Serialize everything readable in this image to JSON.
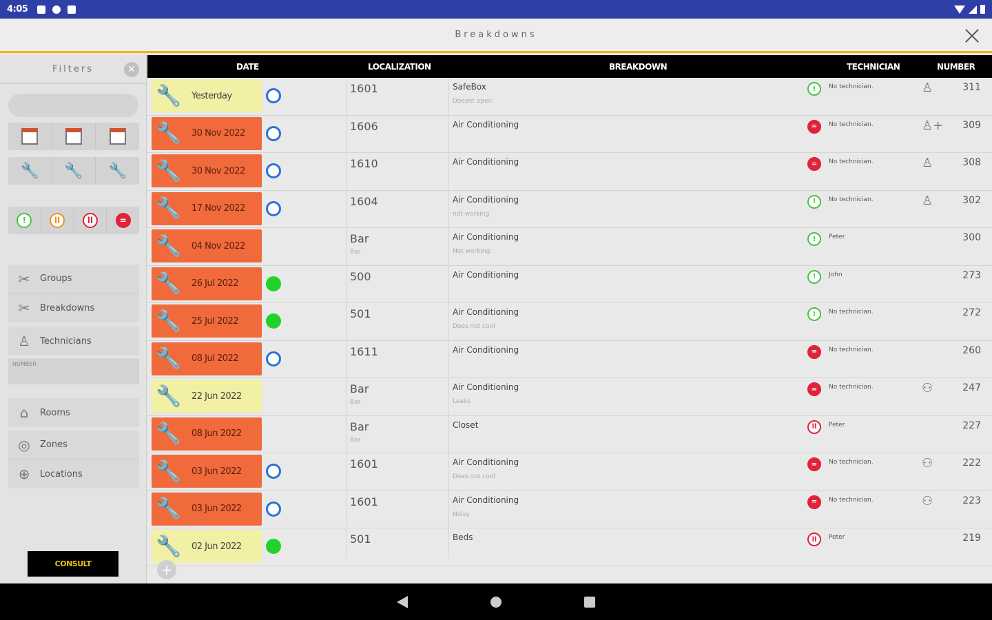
{
  "status_bar": {
    "time": "4:05"
  },
  "header": {
    "title": "Breakdowns"
  },
  "filters": {
    "title": "Filters",
    "clear_icon": "clear-circle-icon"
  },
  "sidebar_menu": {
    "group1": [
      {
        "label": "Groups",
        "icon": "tools-icon"
      },
      {
        "label": "Breakdowns",
        "icon": "tools-icon"
      }
    ],
    "technicians": {
      "label": "Technicians",
      "icon": "person-icon"
    },
    "number_label": "NUMBER",
    "group2": [
      {
        "label": "Rooms",
        "icon": "door-icon"
      },
      {
        "label": "Zones",
        "icon": "zone-icon"
      },
      {
        "label": "Locations",
        "icon": "globe-icon"
      }
    ]
  },
  "consult_label": "CONSULT",
  "table": {
    "columns": {
      "date": "DATE",
      "localization": "LOCALIZATION",
      "breakdown": "BREAKDOWN",
      "technician": "TECHNICIAN",
      "number": "NUMBER"
    },
    "rows": [
      {
        "date": "Yesterday",
        "color": "yellow",
        "user": "blue",
        "loc": "1601",
        "loc_sub": "",
        "bd": "SafeBox",
        "bd_sub": "Doesnt open",
        "status": "open",
        "tech": "No technician.",
        "num_icon": "person-icon",
        "number": "311"
      },
      {
        "date": "30 Nov 2022",
        "color": "red",
        "user": "blue",
        "loc": "1606",
        "loc_sub": "",
        "bd": "Air Conditioning",
        "bd_sub": "",
        "status": "stop",
        "tech": "No technician.",
        "num_icon": "person-add-icon",
        "number": "309"
      },
      {
        "date": "30 Nov 2022",
        "color": "red",
        "user": "blue",
        "loc": "1610",
        "loc_sub": "",
        "bd": "Air Conditioning",
        "bd_sub": "",
        "status": "stop",
        "tech": "No technician.",
        "num_icon": "person-icon",
        "number": "308"
      },
      {
        "date": "17 Nov 2022",
        "color": "red",
        "user": "blue",
        "loc": "1604",
        "loc_sub": "",
        "bd": "Air Conditioning",
        "bd_sub": "not working",
        "status": "open",
        "tech": "No technician.",
        "num_icon": "person-icon",
        "number": "302"
      },
      {
        "date": "04 Nov 2022",
        "color": "red",
        "user": "",
        "loc": "Bar",
        "loc_sub": "Bar",
        "bd": "Air Conditioning",
        "bd_sub": "Not working",
        "status": "open",
        "tech": "Peter",
        "num_icon": "",
        "number": "300"
      },
      {
        "date": "26 Jul 2022",
        "color": "red",
        "user": "green",
        "loc": "500",
        "loc_sub": "",
        "bd": "Air Conditioning",
        "bd_sub": "",
        "status": "open",
        "tech": "John",
        "num_icon": "",
        "number": "273"
      },
      {
        "date": "25 Jul 2022",
        "color": "red",
        "user": "green",
        "loc": "501",
        "loc_sub": "",
        "bd": "Air Conditioning",
        "bd_sub": "Does not cool",
        "status": "open",
        "tech": "No technician.",
        "num_icon": "",
        "number": "272"
      },
      {
        "date": "08 Jul 2022",
        "color": "red",
        "user": "blue",
        "loc": "1611",
        "loc_sub": "",
        "bd": "Air Conditioning",
        "bd_sub": "",
        "status": "stop",
        "tech": "No technician.",
        "num_icon": "",
        "number": "260"
      },
      {
        "date": "22 Jun 2022",
        "color": "yellow",
        "user": "",
        "loc": "Bar",
        "loc_sub": "Bar",
        "bd": "Air Conditioning",
        "bd_sub": "Leaks",
        "status": "stop",
        "tech": "No technician.",
        "num_icon": "group-icon",
        "number": "247"
      },
      {
        "date": "08 Jun 2022",
        "color": "red",
        "user": "",
        "loc": "Bar",
        "loc_sub": "Bar",
        "bd": "Closet",
        "bd_sub": "",
        "status": "paused",
        "tech": "Peter",
        "num_icon": "",
        "number": "227"
      },
      {
        "date": "03 Jun 2022",
        "color": "red",
        "user": "blue",
        "loc": "1601",
        "loc_sub": "",
        "bd": "Air Conditioning",
        "bd_sub": "Does not cool",
        "status": "stop",
        "tech": "No technician.",
        "num_icon": "group-icon",
        "number": "222"
      },
      {
        "date": "03 Jun 2022",
        "color": "red",
        "user": "blue",
        "loc": "1601",
        "loc_sub": "",
        "bd": "Air Conditioning",
        "bd_sub": "Noisy",
        "status": "stop",
        "tech": "No technician.",
        "num_icon": "group-icon",
        "number": "223"
      },
      {
        "date": "02 Jun 2022",
        "color": "yellow",
        "user": "green",
        "loc": "501",
        "loc_sub": "",
        "bd": "Beds",
        "bd_sub": "",
        "status": "paused",
        "tech": "Peter",
        "num_icon": "",
        "number": "219"
      }
    ]
  },
  "colors": {
    "accent": "#f0b400",
    "status_bar": "#2f3fa8",
    "date_red": "#f06a3c",
    "date_yellow": "#f2f0a4",
    "consult_text": "#e8c21a"
  }
}
